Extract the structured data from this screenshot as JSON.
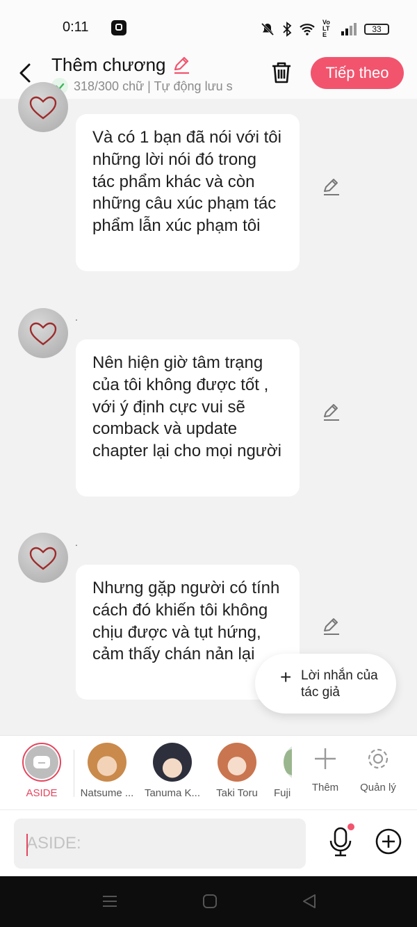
{
  "status_bar": {
    "time": "0:11",
    "battery": "33",
    "network_label": "VoLTE"
  },
  "header": {
    "title": "Thêm chương",
    "status": "318/300 chữ | Tự động lưu s",
    "next_label": "Tiếp theo"
  },
  "messages": [
    {
      "name_dot": "",
      "text": "Và có 1 bạn đã nói với tôi những lời nói đó trong tác phẩm khác và còn những câu xúc phạm tác phẩm lẫn xúc phạm tôi"
    },
    {
      "name_dot": ".",
      "text": "Nên hiện giờ tâm trạng của tôi không được tốt , với ý định cực vui sẽ comback và update chapter lại cho mọi người"
    },
    {
      "name_dot": ".",
      "text": "Nhưng gặp người có tính cách đó khiến tôi không chịu được và tụt hứng, cảm thấy chán nản lại"
    }
  ],
  "author_note_button": {
    "label": "Lời nhắn của tác giả"
  },
  "characters": [
    {
      "label": "ASIDE"
    },
    {
      "label": "Natsume ..."
    },
    {
      "label": "Tanuma K..."
    },
    {
      "label": "Taki Toru"
    },
    {
      "label": "Fuji"
    },
    {
      "label": "Thêm"
    },
    {
      "label": "Quản lý"
    }
  ],
  "input": {
    "placeholder": "ASIDE:"
  },
  "colors": {
    "accent": "#f2546e",
    "aside_red": "#e5455e",
    "background": "#f2f2f2"
  }
}
